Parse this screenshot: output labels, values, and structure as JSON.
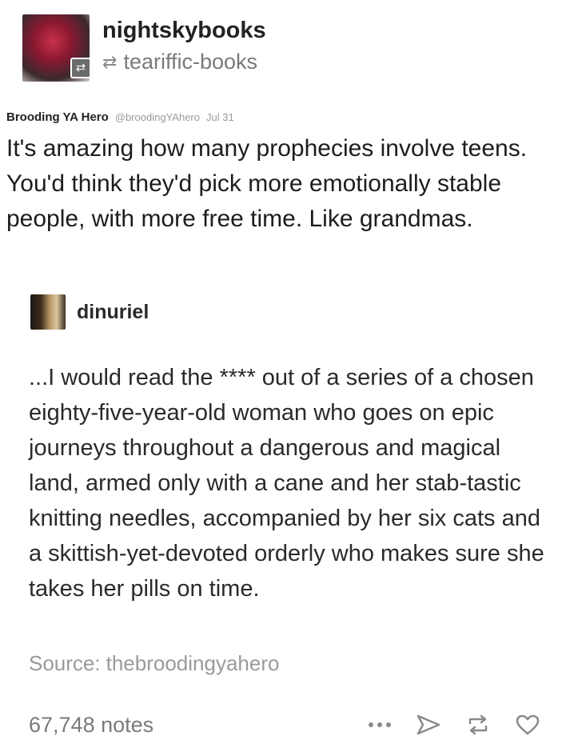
{
  "header": {
    "blog_name": "nightskybooks",
    "reblogged_from": "teariffic-books",
    "avatar_icon": "blog-avatar",
    "reblog_icon": "reblog-icon"
  },
  "tweet": {
    "author": "Brooding YA Hero",
    "handle": "@broodingYAhero",
    "date": "Jul 31",
    "text": "It's amazing how many prophecies  involve teens. You'd think they'd pick more emotionally stable people, with more free time. Like grandmas."
  },
  "reply": {
    "username": "dinuriel",
    "text": "...I would read the **** out of a series of a chosen eighty-five-year-old woman who goes on epic journeys throughout a dangerous and magical land, armed only with a cane and her stab-tastic knitting needles, accompanied by her six cats and a skittish-yet-devoted orderly who makes sure she takes her pills on time."
  },
  "source": {
    "label": "Source:",
    "value": "thebroodingyahero"
  },
  "footer": {
    "notes": "67,748 notes",
    "icons": [
      "more-icon",
      "share-icon",
      "reblog-icon",
      "heart-icon"
    ]
  }
}
